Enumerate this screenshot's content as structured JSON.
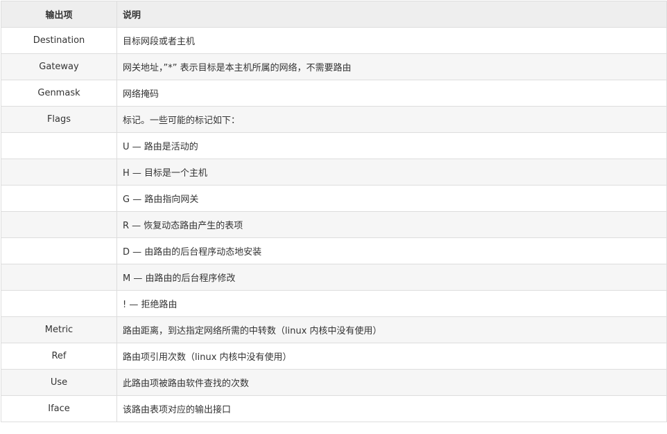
{
  "table": {
    "headers": [
      "输出项",
      "说明"
    ],
    "rows": [
      [
        "Destination",
        "目标网段或者主机"
      ],
      [
        "Gateway",
        "网关地址，”*” 表示目标是本主机所属的网络，不需要路由"
      ],
      [
        "Genmask",
        "网络掩码"
      ],
      [
        "Flags",
        "标记。一些可能的标记如下："
      ],
      [
        "",
        "U — 路由是活动的"
      ],
      [
        "",
        "H — 目标是一个主机"
      ],
      [
        "",
        "G — 路由指向网关"
      ],
      [
        "",
        "R — 恢复动态路由产生的表项"
      ],
      [
        "",
        "D — 由路由的后台程序动态地安装"
      ],
      [
        "",
        "M — 由路由的后台程序修改"
      ],
      [
        "",
        "! — 拒绝路由"
      ],
      [
        "Metric",
        "路由距离，到达指定网络所需的中转数（linux 内核中没有使用）"
      ],
      [
        "Ref",
        "路由项引用次数（linux 内核中没有使用）"
      ],
      [
        "Use",
        "此路由项被路由软件查找的次数"
      ],
      [
        "Iface",
        "该路由表项对应的输出接口"
      ]
    ]
  }
}
